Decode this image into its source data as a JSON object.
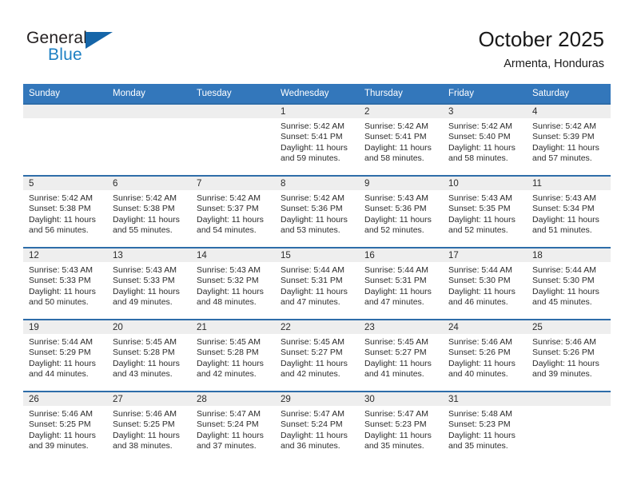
{
  "brand": {
    "name_top": "General",
    "name_bottom": "Blue",
    "logo_icon": "blue-triangle-icon",
    "color_dark": "#231f20",
    "color_blue": "#1d7fc3"
  },
  "header": {
    "title": "October 2025",
    "subtitle": "Armenta, Honduras"
  },
  "theme": {
    "header_row_bg": "#3377bb",
    "row_divider": "#2e6da9",
    "daynum_band_bg": "#eeeeee",
    "text": "#2b2b2b"
  },
  "weekdays": [
    "Sunday",
    "Monday",
    "Tuesday",
    "Wednesday",
    "Thursday",
    "Friday",
    "Saturday"
  ],
  "labels": {
    "sunrise_prefix": "Sunrise:",
    "sunset_prefix": "Sunset:",
    "daylight_prefix": "Daylight:"
  },
  "weeks": [
    [
      {
        "day": "",
        "blank": true
      },
      {
        "day": "",
        "blank": true
      },
      {
        "day": "",
        "blank": true
      },
      {
        "day": "1",
        "sunrise": "Sunrise: 5:42 AM",
        "sunset": "Sunset: 5:41 PM",
        "daylight": "Daylight: 11 hours and 59 minutes."
      },
      {
        "day": "2",
        "sunrise": "Sunrise: 5:42 AM",
        "sunset": "Sunset: 5:41 PM",
        "daylight": "Daylight: 11 hours and 58 minutes."
      },
      {
        "day": "3",
        "sunrise": "Sunrise: 5:42 AM",
        "sunset": "Sunset: 5:40 PM",
        "daylight": "Daylight: 11 hours and 58 minutes."
      },
      {
        "day": "4",
        "sunrise": "Sunrise: 5:42 AM",
        "sunset": "Sunset: 5:39 PM",
        "daylight": "Daylight: 11 hours and 57 minutes."
      }
    ],
    [
      {
        "day": "5",
        "sunrise": "Sunrise: 5:42 AM",
        "sunset": "Sunset: 5:38 PM",
        "daylight": "Daylight: 11 hours and 56 minutes."
      },
      {
        "day": "6",
        "sunrise": "Sunrise: 5:42 AM",
        "sunset": "Sunset: 5:38 PM",
        "daylight": "Daylight: 11 hours and 55 minutes."
      },
      {
        "day": "7",
        "sunrise": "Sunrise: 5:42 AM",
        "sunset": "Sunset: 5:37 PM",
        "daylight": "Daylight: 11 hours and 54 minutes."
      },
      {
        "day": "8",
        "sunrise": "Sunrise: 5:42 AM",
        "sunset": "Sunset: 5:36 PM",
        "daylight": "Daylight: 11 hours and 53 minutes."
      },
      {
        "day": "9",
        "sunrise": "Sunrise: 5:43 AM",
        "sunset": "Sunset: 5:36 PM",
        "daylight": "Daylight: 11 hours and 52 minutes."
      },
      {
        "day": "10",
        "sunrise": "Sunrise: 5:43 AM",
        "sunset": "Sunset: 5:35 PM",
        "daylight": "Daylight: 11 hours and 52 minutes."
      },
      {
        "day": "11",
        "sunrise": "Sunrise: 5:43 AM",
        "sunset": "Sunset: 5:34 PM",
        "daylight": "Daylight: 11 hours and 51 minutes."
      }
    ],
    [
      {
        "day": "12",
        "sunrise": "Sunrise: 5:43 AM",
        "sunset": "Sunset: 5:33 PM",
        "daylight": "Daylight: 11 hours and 50 minutes."
      },
      {
        "day": "13",
        "sunrise": "Sunrise: 5:43 AM",
        "sunset": "Sunset: 5:33 PM",
        "daylight": "Daylight: 11 hours and 49 minutes."
      },
      {
        "day": "14",
        "sunrise": "Sunrise: 5:43 AM",
        "sunset": "Sunset: 5:32 PM",
        "daylight": "Daylight: 11 hours and 48 minutes."
      },
      {
        "day": "15",
        "sunrise": "Sunrise: 5:44 AM",
        "sunset": "Sunset: 5:31 PM",
        "daylight": "Daylight: 11 hours and 47 minutes."
      },
      {
        "day": "16",
        "sunrise": "Sunrise: 5:44 AM",
        "sunset": "Sunset: 5:31 PM",
        "daylight": "Daylight: 11 hours and 47 minutes."
      },
      {
        "day": "17",
        "sunrise": "Sunrise: 5:44 AM",
        "sunset": "Sunset: 5:30 PM",
        "daylight": "Daylight: 11 hours and 46 minutes."
      },
      {
        "day": "18",
        "sunrise": "Sunrise: 5:44 AM",
        "sunset": "Sunset: 5:30 PM",
        "daylight": "Daylight: 11 hours and 45 minutes."
      }
    ],
    [
      {
        "day": "19",
        "sunrise": "Sunrise: 5:44 AM",
        "sunset": "Sunset: 5:29 PM",
        "daylight": "Daylight: 11 hours and 44 minutes."
      },
      {
        "day": "20",
        "sunrise": "Sunrise: 5:45 AM",
        "sunset": "Sunset: 5:28 PM",
        "daylight": "Daylight: 11 hours and 43 minutes."
      },
      {
        "day": "21",
        "sunrise": "Sunrise: 5:45 AM",
        "sunset": "Sunset: 5:28 PM",
        "daylight": "Daylight: 11 hours and 42 minutes."
      },
      {
        "day": "22",
        "sunrise": "Sunrise: 5:45 AM",
        "sunset": "Sunset: 5:27 PM",
        "daylight": "Daylight: 11 hours and 42 minutes."
      },
      {
        "day": "23",
        "sunrise": "Sunrise: 5:45 AM",
        "sunset": "Sunset: 5:27 PM",
        "daylight": "Daylight: 11 hours and 41 minutes."
      },
      {
        "day": "24",
        "sunrise": "Sunrise: 5:46 AM",
        "sunset": "Sunset: 5:26 PM",
        "daylight": "Daylight: 11 hours and 40 minutes."
      },
      {
        "day": "25",
        "sunrise": "Sunrise: 5:46 AM",
        "sunset": "Sunset: 5:26 PM",
        "daylight": "Daylight: 11 hours and 39 minutes."
      }
    ],
    [
      {
        "day": "26",
        "sunrise": "Sunrise: 5:46 AM",
        "sunset": "Sunset: 5:25 PM",
        "daylight": "Daylight: 11 hours and 39 minutes."
      },
      {
        "day": "27",
        "sunrise": "Sunrise: 5:46 AM",
        "sunset": "Sunset: 5:25 PM",
        "daylight": "Daylight: 11 hours and 38 minutes."
      },
      {
        "day": "28",
        "sunrise": "Sunrise: 5:47 AM",
        "sunset": "Sunset: 5:24 PM",
        "daylight": "Daylight: 11 hours and 37 minutes."
      },
      {
        "day": "29",
        "sunrise": "Sunrise: 5:47 AM",
        "sunset": "Sunset: 5:24 PM",
        "daylight": "Daylight: 11 hours and 36 minutes."
      },
      {
        "day": "30",
        "sunrise": "Sunrise: 5:47 AM",
        "sunset": "Sunset: 5:23 PM",
        "daylight": "Daylight: 11 hours and 35 minutes."
      },
      {
        "day": "31",
        "sunrise": "Sunrise: 5:48 AM",
        "sunset": "Sunset: 5:23 PM",
        "daylight": "Daylight: 11 hours and 35 minutes."
      },
      {
        "day": "",
        "blank": true
      }
    ]
  ]
}
